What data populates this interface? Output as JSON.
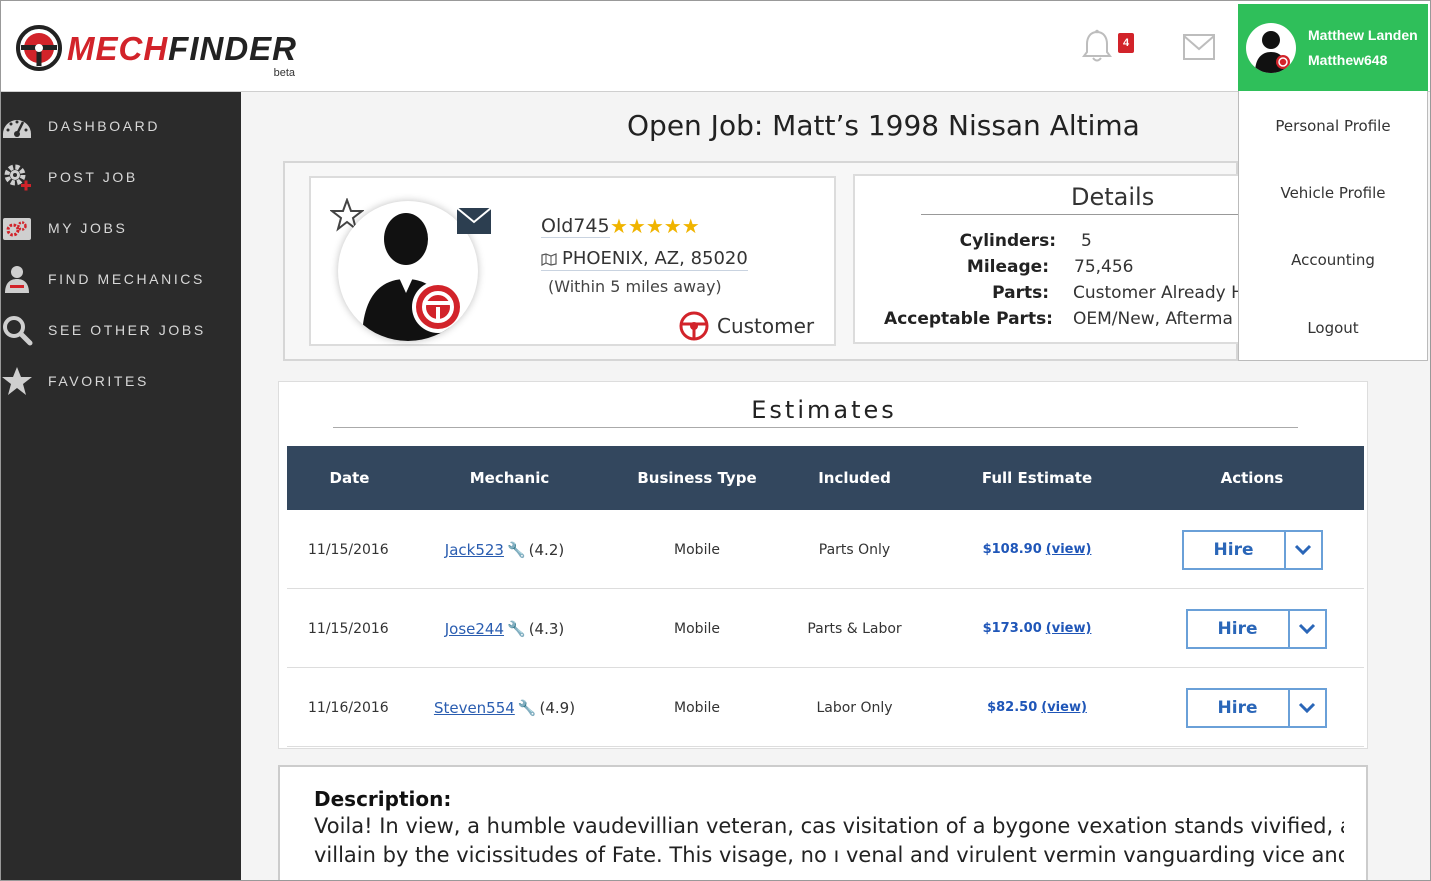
{
  "brand": {
    "logo_red": "MECH",
    "logo_dark": "FINDER",
    "beta": "beta"
  },
  "header": {
    "notification_count": "4",
    "user": {
      "full_name": "Matthew Landen",
      "username": "Matthew648"
    }
  },
  "user_menu": {
    "items": [
      {
        "label": "Personal Profile"
      },
      {
        "label": "Vehicle Profile"
      },
      {
        "label": "Accounting"
      },
      {
        "label": "Logout"
      }
    ]
  },
  "sidebar": {
    "items": [
      {
        "label": "DASHBOARD",
        "icon": "dashboard-gauge-icon"
      },
      {
        "label": "POST JOB",
        "icon": "gear-plus-icon"
      },
      {
        "label": "MY JOBS",
        "icon": "gears-folder-icon"
      },
      {
        "label": "FIND MECHANICS",
        "icon": "mechanic-person-icon"
      },
      {
        "label": "SEE OTHER JOBS",
        "icon": "magnifier-icon"
      },
      {
        "label": "FAVORITES",
        "icon": "star-icon"
      }
    ]
  },
  "page": {
    "title": "Open Job: Matt’s 1998 Nissan Altima"
  },
  "poster": {
    "username": "Old745",
    "stars": "★★★★★",
    "location": "PHOENIX, AZ, 85020",
    "distance": "(Within 5 miles away)",
    "role": "Customer"
  },
  "details": {
    "title": "Details",
    "rows": [
      {
        "label": "Cylinders:",
        "value": "5"
      },
      {
        "label": "Mileage:",
        "value": "75,456"
      },
      {
        "label": "Parts:",
        "value": "Customer Already H"
      },
      {
        "label": "Acceptable Parts:",
        "value": "OEM/New, Afterma"
      }
    ]
  },
  "estimates": {
    "title": "Estimates",
    "columns": [
      "Date",
      "Mechanic",
      "Business Type",
      "Included",
      "Full Estimate",
      "Actions"
    ],
    "rows": [
      {
        "date": "11/15/2016",
        "mechanic": "Jack523",
        "rating": "(4.2)",
        "business_type": "Mobile",
        "included": "Parts Only",
        "price": "$108.90",
        "view": "(view)",
        "action": "Hire"
      },
      {
        "date": "11/15/2016",
        "mechanic": "Jose244",
        "rating": "(4.3)",
        "business_type": "Mobile",
        "included": "Parts & Labor",
        "price": "$173.00",
        "view": "(view)",
        "action": "Hire"
      },
      {
        "date": "11/16/2016",
        "mechanic": "Steven554",
        "rating": "(4.9)",
        "business_type": "Mobile",
        "included": "Labor Only",
        "price": "$82.50",
        "view": "(view)",
        "action": "Hire"
      }
    ]
  },
  "description": {
    "title": "Description:",
    "line1": "Voila! In view, a humble vaudevillian veteran, cas visitation of a bygone vexation stands vivified, ar",
    "line2": "villain by the vicissitudes of Fate. This visage, no ı venal and virulent vermin vanguarding vice and \\"
  },
  "colors": {
    "accent_green": "#2fbf5a",
    "brand_red": "#d2232a",
    "table_header": "#33475e",
    "sidebar_bg": "#2b2b2b",
    "link_blue": "#2a5db0"
  }
}
